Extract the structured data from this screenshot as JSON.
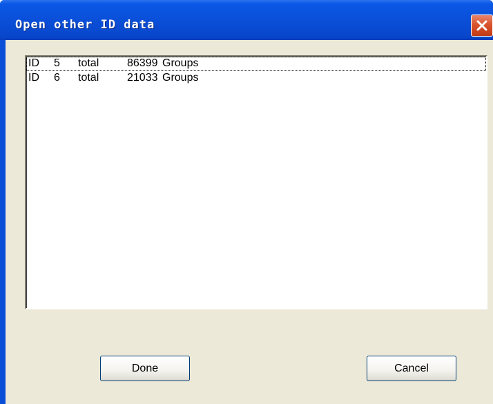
{
  "window": {
    "title": "Open other ID data"
  },
  "list": {
    "items": [
      {
        "id_label": "ID",
        "id": "5",
        "total_label": "total",
        "count": "86399",
        "unit": "Groups",
        "focused": true
      },
      {
        "id_label": "ID",
        "id": "6",
        "total_label": "total",
        "count": "21033",
        "unit": "Groups",
        "focused": false
      }
    ]
  },
  "buttons": {
    "done_label": "Done",
    "cancel_label": "Cancel"
  },
  "icons": {
    "close": "close-icon"
  },
  "colors": {
    "titlebar": "#0a4fd8",
    "close_button": "#d9542e",
    "dialog_background": "#ece9d8"
  }
}
